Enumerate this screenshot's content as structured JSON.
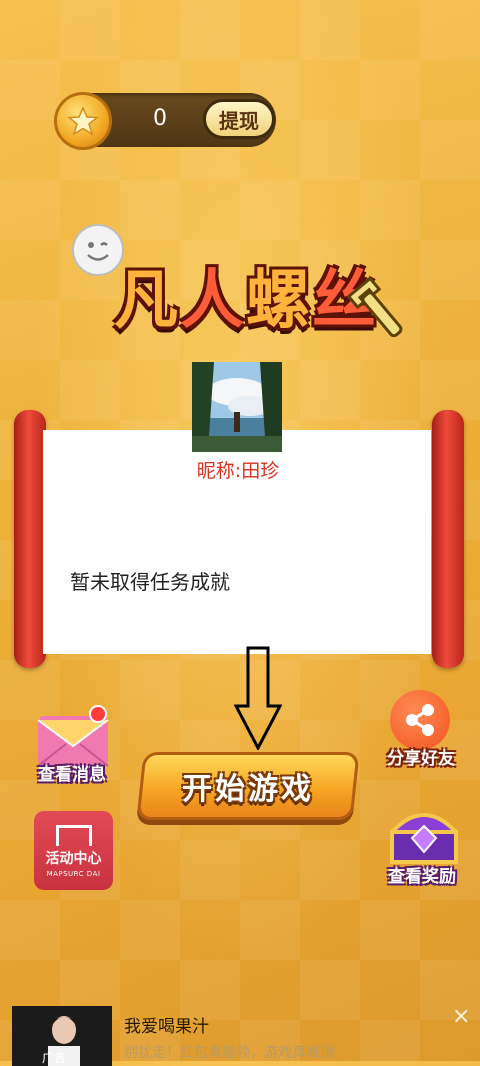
{
  "coin": {
    "value": "0",
    "withdraw_label": "提现"
  },
  "title": {
    "chars": [
      "凡",
      "人",
      "螺",
      "丝"
    ]
  },
  "profile": {
    "nickname": "昵称:田珍"
  },
  "achievement": {
    "text": "暂未取得任务成就"
  },
  "buttons": {
    "messages": "查看消息",
    "share": "分享好友",
    "start": "开始游戏",
    "rewards": "查看奖励",
    "activity_title": "活动中心",
    "activity_sub": "MAPSURC DAI"
  },
  "ad": {
    "title": "我爱喝果汁",
    "subtitle": "别犹走！红包真能领，游戏真难顶",
    "tag": "广告",
    "close": "×"
  },
  "colors": {
    "background": "#efb43e",
    "scroll_rod": "#ef4a3b",
    "start_button": "#f6a522"
  }
}
